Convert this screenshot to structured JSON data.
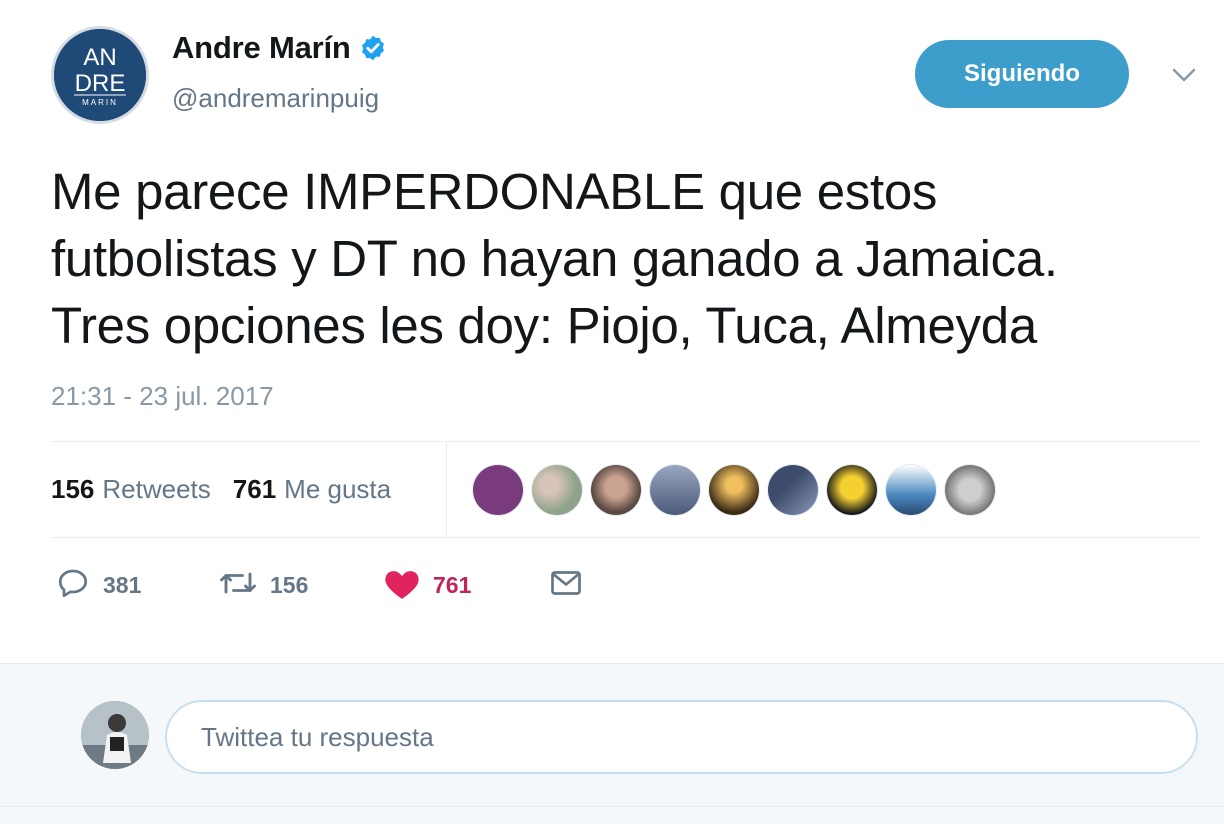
{
  "colors": {
    "accent": "#3d9ecb",
    "like": "#e0245e",
    "text": "#14171a",
    "muted": "#657786",
    "verified": "#1da1f2"
  },
  "author": {
    "display_name": "Andre Marín",
    "handle": "@andremarinpuig",
    "verified": true,
    "avatar_text": {
      "line1": "AN",
      "line2": "DRE",
      "line3": "MARIN"
    }
  },
  "follow_button": {
    "label": "Siguiendo"
  },
  "menu_icon": "chevron-down-icon",
  "tweet": {
    "lines": [
      "Me parece IMPERDONABLE que estos",
      "futbolistas y DT no hayan ganado a Jamaica.",
      "Tres opciones les doy: Piojo, Tuca, Almeyda"
    ],
    "timestamp": "21:31 - 23 jul. 2017"
  },
  "stats": {
    "retweets": {
      "count": "156",
      "label": "Retweets"
    },
    "likes": {
      "count": "761",
      "label": "Me gusta"
    }
  },
  "likers": [
    {
      "icon": "liker-avatar",
      "color": "#7a3b7d"
    },
    {
      "icon": "liker-avatar",
      "color": "#8fa38c"
    },
    {
      "icon": "liker-avatar",
      "color": "#5c4a44"
    },
    {
      "icon": "liker-avatar",
      "color": "#4a5a78"
    },
    {
      "icon": "liker-avatar",
      "color": "#b8860b"
    },
    {
      "icon": "liker-avatar",
      "color": "#3c4c6a"
    },
    {
      "icon": "liker-avatar",
      "color": "#e0b020"
    },
    {
      "icon": "liker-avatar",
      "color": "#4a88c0"
    },
    {
      "icon": "liker-avatar",
      "color": "#6a6a6a"
    }
  ],
  "actions": {
    "reply": {
      "icon": "reply-icon",
      "count": "381"
    },
    "retweet": {
      "icon": "retweet-icon",
      "count": "156"
    },
    "like": {
      "icon": "heart-icon",
      "count": "761",
      "active": true
    },
    "dm": {
      "icon": "envelope-icon"
    }
  },
  "reply_box": {
    "placeholder": "Twittea tu respuesta"
  }
}
